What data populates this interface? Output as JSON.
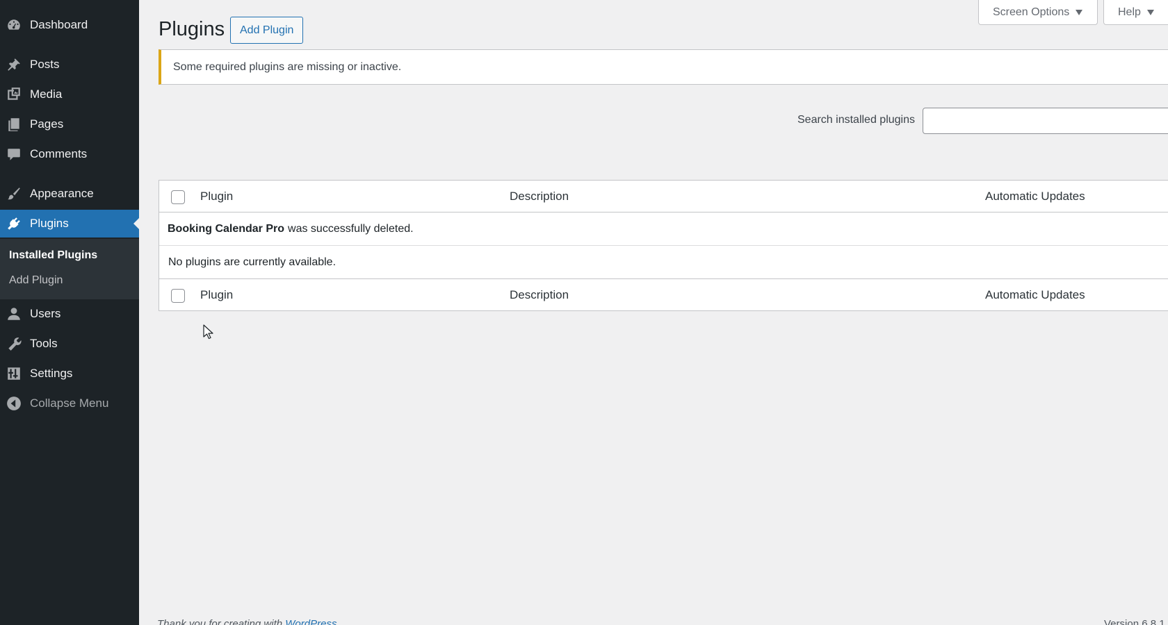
{
  "sidebar": {
    "items": [
      {
        "label": "Dashboard",
        "icon": "dashboard-icon"
      },
      {
        "label": "Posts",
        "icon": "pin-icon"
      },
      {
        "label": "Media",
        "icon": "media-icon"
      },
      {
        "label": "Pages",
        "icon": "pages-icon"
      },
      {
        "label": "Comments",
        "icon": "comment-icon"
      },
      {
        "label": "Appearance",
        "icon": "brush-icon"
      },
      {
        "label": "Plugins",
        "icon": "plug-icon"
      },
      {
        "label": "Users",
        "icon": "user-icon"
      },
      {
        "label": "Tools",
        "icon": "wrench-icon"
      },
      {
        "label": "Settings",
        "icon": "settings-icon"
      },
      {
        "label": "Collapse Menu",
        "icon": "collapse-icon"
      }
    ],
    "submenu": [
      {
        "label": "Installed Plugins"
      },
      {
        "label": "Add Plugin"
      }
    ]
  },
  "header": {
    "title": "Plugins",
    "add_button": "Add Plugin",
    "screen_options": "Screen Options",
    "help": "Help"
  },
  "notice": {
    "text": "Some required plugins are missing or inactive."
  },
  "search": {
    "label": "Search installed plugins",
    "value": "",
    "placeholder": ""
  },
  "table": {
    "columns": [
      "Plugin",
      "Description",
      "Automatic Updates"
    ],
    "deleted_plugin": "Booking Calendar Pro",
    "deleted_suffix": "was successfully deleted.",
    "empty_message": "No plugins are currently available."
  },
  "footer": {
    "left_prefix": "Thank you for creating with",
    "left_link": "WordPress",
    "version": "Version 6.8.1"
  },
  "colors": {
    "sidebar_bg": "#1d2327",
    "accent": "#2271b1",
    "notice_warning": "#dba617",
    "page_bg": "#f0f0f1"
  }
}
